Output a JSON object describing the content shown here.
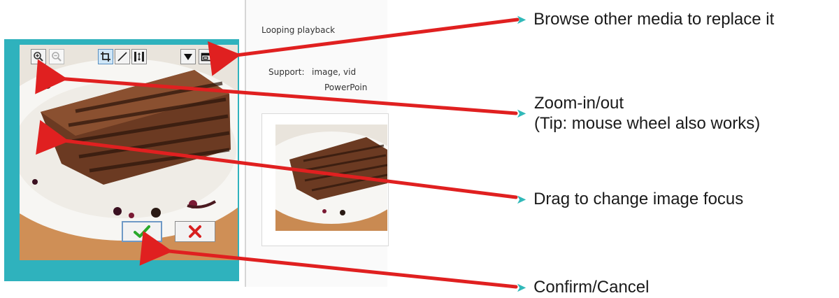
{
  "panel": {
    "looping_label": "Looping playback",
    "support_label": "Support:",
    "support_value": "image, vid",
    "support_value_2": "PowerPoin"
  },
  "toolbar": {
    "zoom_in_icon": "zoom-in-icon",
    "zoom_out_icon": "zoom-out-icon",
    "crop_icon": "crop-icon",
    "stretch_icon": "diagonal-stretch-icon",
    "fit_icon": "fit-height-icon",
    "dropdown_icon": "dropdown-arrow-icon",
    "browse_icon": "browse-media-icon"
  },
  "actions": {
    "confirm_icon": "checkmark-icon",
    "cancel_icon": "cross-icon"
  },
  "callouts": {
    "browse": "Browse other media to replace it",
    "zoom": "Zoom-in/out",
    "zoom_tip": "(Tip: mouse wheel also works)",
    "drag": "Drag to change image focus",
    "confirm": "Confirm/Cancel"
  },
  "colors": {
    "accent_teal": "#2fb2bd",
    "arrow_red": "#e02020",
    "chevron_teal": "#31b9b9",
    "confirm_green": "#2aa82a",
    "cancel_red": "#d81f1f"
  }
}
